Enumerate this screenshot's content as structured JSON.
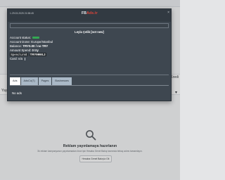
{
  "background": {
    "left_label": "Yayın",
    "right_label": "Kredi",
    "empty_state": {
      "title": "Reklam yayınlamaya hazırlanın",
      "subtitle": "İlk reklam kampanyanızı yayınlamadan önce işin Hesaba Genel Bakış kısmında birkaç adımı tamamlayın.",
      "button_label": "Hesaba Genel Bakış'a Git"
    }
  },
  "modal": {
    "datetime": "1.29.03.2025 21:58:45",
    "title_prefix": "FB",
    "title_suffix": "Ads.tr",
    "account_name": "Leyla Çelik [not new]",
    "info": {
      "status_label": "Account status:",
      "timezone": "Account tzone: Europe/Istanbul",
      "balance_label": "Balance:",
      "balance_value": "TRY0.00 / no TRY",
      "amount_spend_label": "Amount Spend:",
      "amount_spend_value": "0 try",
      "spend_limit_label": "Spend Limit:",
      "spend_limit_value": "TRY9990.2",
      "card_label": "Card:",
      "card_value": "n/a"
    },
    "tabs": [
      {
        "label": "Ads"
      },
      {
        "label": "AdsCo(7)"
      },
      {
        "label": "Pages"
      },
      {
        "label": "Businesses"
      }
    ],
    "no_ads": "No ads"
  },
  "colors": {
    "modal_bg": "#3e4750",
    "status_green": "#34a853",
    "brand_red": "#e0443a"
  }
}
